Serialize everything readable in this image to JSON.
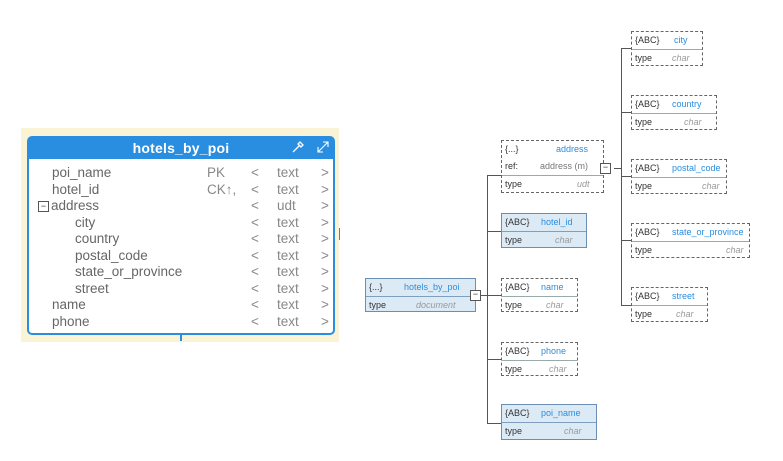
{
  "entity": {
    "title": "hotels_by_poi",
    "rows": [
      {
        "name": "poi_name",
        "key": "PK",
        "lt": "<",
        "type": "text",
        "gt": ">"
      },
      {
        "name": "hotel_id",
        "key": "CK↑,",
        "lt": "<",
        "type": "text",
        "gt": ">"
      },
      {
        "name": "address",
        "key": "",
        "lt": "<",
        "type": "udt",
        "gt": ">"
      },
      {
        "name": "city",
        "key": "",
        "lt": "<",
        "type": "text",
        "gt": ">"
      },
      {
        "name": "country",
        "key": "",
        "lt": "<",
        "type": "text",
        "gt": ">"
      },
      {
        "name": "postal_code",
        "key": "",
        "lt": "<",
        "type": "text",
        "gt": ">"
      },
      {
        "name": "state_or_province",
        "key": "",
        "lt": "<",
        "type": "text",
        "gt": ">"
      },
      {
        "name": "street",
        "key": "",
        "lt": "<",
        "type": "text",
        "gt": ">"
      },
      {
        "name": "name",
        "key": "",
        "lt": "<",
        "type": "text",
        "gt": ">"
      },
      {
        "name": "phone",
        "key": "",
        "lt": "<",
        "type": "text",
        "gt": ">"
      }
    ],
    "collapse_symbol": "−",
    "icons": [
      "eyedropper-icon",
      "expand-icon"
    ]
  },
  "tree": {
    "root": {
      "badge": "{...}",
      "name": "hotels_by_poi",
      "type_label": "type",
      "type": "document"
    },
    "children": [
      {
        "badge": "{...}",
        "name": "address",
        "ref_label": "ref:",
        "ref": "address (m)",
        "type_label": "type",
        "type": "udt"
      },
      {
        "badge": "{ABC}",
        "name": "hotel_id",
        "type_label": "type",
        "type": "char"
      },
      {
        "badge": "{ABC}",
        "name": "name",
        "type_label": "type",
        "type": "char"
      },
      {
        "badge": "{ABC}",
        "name": "phone",
        "type_label": "type",
        "type": "char"
      },
      {
        "badge": "{ABC}",
        "name": "poi_name",
        "type_label": "type",
        "type": "char"
      }
    ],
    "address_children": [
      {
        "badge": "{ABC}",
        "name": "city",
        "type_label": "type",
        "type": "char"
      },
      {
        "badge": "{ABC}",
        "name": "country",
        "type_label": "type",
        "type": "char"
      },
      {
        "badge": "{ABC}",
        "name": "postal_code",
        "type_label": "type",
        "type": "char"
      },
      {
        "badge": "{ABC}",
        "name": "state_or_province",
        "type_label": "type",
        "type": "char"
      },
      {
        "badge": "{ABC}",
        "name": "street",
        "type_label": "type",
        "type": "char"
      }
    ],
    "collapse_symbol": "−"
  }
}
